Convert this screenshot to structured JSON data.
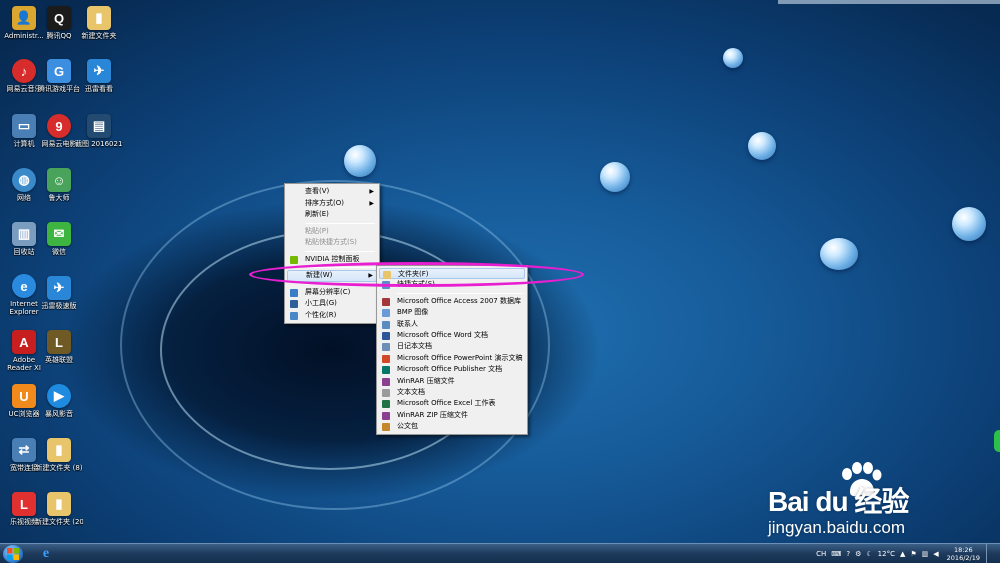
{
  "desktop": {
    "icons": [
      {
        "label": "Administr...",
        "glyph": "👤",
        "color": "#d9a630"
      },
      {
        "label": "腾讯QQ",
        "glyph": "Q",
        "color": "#1b1b1b"
      },
      {
        "label": "新建文件夹",
        "glyph": "▮",
        "color": "#e8c46a"
      },
      {
        "label": "网易云音乐",
        "glyph": "♪",
        "color": "#d62c2c"
      },
      {
        "label": "腾讯游戏平台",
        "glyph": "G",
        "color": "#3c8ee0"
      },
      {
        "label": "迅雷看看",
        "glyph": "✈",
        "color": "#2a86d6"
      },
      {
        "label": "计算机",
        "glyph": "▭",
        "color": "#4a7fb5"
      },
      {
        "label": "网易云电影",
        "glyph": "9",
        "color": "#d62c2c"
      },
      {
        "label": "截图 20160219...",
        "glyph": "▤",
        "color": "#234a70"
      },
      {
        "label": "网络",
        "glyph": "◍",
        "color": "#3a89c9"
      },
      {
        "label": "鲁大师",
        "glyph": "☺",
        "color": "#4aa35a"
      },
      {
        "label": "回收站",
        "glyph": "▥",
        "color": "#7a9cbf"
      },
      {
        "label": "微信",
        "glyph": "✉",
        "color": "#3fb541"
      },
      {
        "label": "Internet Explorer",
        "glyph": "e",
        "color": "#2a8ae0"
      },
      {
        "label": "迅雷极速版",
        "glyph": "✈",
        "color": "#2a86d6"
      },
      {
        "label": "Adobe Reader XI",
        "glyph": "A",
        "color": "#c71f1f"
      },
      {
        "label": "英雄联盟",
        "glyph": "L",
        "color": "#6f5a26"
      },
      {
        "label": "UC浏览器",
        "glyph": "U",
        "color": "#f08a1c"
      },
      {
        "label": "暴风影音",
        "glyph": "▶",
        "color": "#1f8be0"
      },
      {
        "label": "宽带连接",
        "glyph": "⇄",
        "color": "#4a7fb5"
      },
      {
        "label": "新建文件夹 (8)",
        "glyph": "▮",
        "color": "#e8c46a"
      },
      {
        "label": "乐视视频",
        "glyph": "L",
        "color": "#e03030"
      },
      {
        "label": "新建文件夹 (20)",
        "glyph": "▮",
        "color": "#e8c46a"
      }
    ]
  },
  "context_menu": {
    "items": [
      {
        "label": "查看(V)",
        "type": "submenu"
      },
      {
        "label": "排序方式(O)",
        "type": "submenu"
      },
      {
        "label": "刷新(E)",
        "type": "item"
      },
      {
        "label": "粘贴(P)",
        "type": "disabled"
      },
      {
        "label": "粘贴快捷方式(S)",
        "type": "disabled"
      },
      {
        "label": "NVIDIA 控制面板",
        "type": "item"
      },
      {
        "label": "新建(W)",
        "type": "submenu"
      },
      {
        "label": "屏幕分辨率(C)",
        "type": "item"
      },
      {
        "label": "小工具(G)",
        "type": "item"
      },
      {
        "label": "个性化(R)",
        "type": "item"
      }
    ]
  },
  "new_submenu": {
    "items": [
      {
        "label": "文件夹(F)",
        "icon_color": "#e8c46a"
      },
      {
        "label": "快捷方式(S)",
        "icon_color": "#5b8ec7"
      },
      {
        "label": "Microsoft Office Access 2007 数据库",
        "icon_color": "#a4373a"
      },
      {
        "label": "BMP 图像",
        "icon_color": "#6a9bd8"
      },
      {
        "label": "联系人",
        "icon_color": "#5a8cc0"
      },
      {
        "label": "Microsoft Office Word 文档",
        "icon_color": "#2b579a"
      },
      {
        "label": "日记本文档",
        "icon_color": "#6d8fb5"
      },
      {
        "label": "Microsoft Office PowerPoint 演示文稿",
        "icon_color": "#d24726"
      },
      {
        "label": "Microsoft Office Publisher 文档",
        "icon_color": "#077568"
      },
      {
        "label": "WinRAR 压缩文件",
        "icon_color": "#8a3f91"
      },
      {
        "label": "文本文档",
        "icon_color": "#9a9a9a"
      },
      {
        "label": "Microsoft Office Excel 工作表",
        "icon_color": "#217346"
      },
      {
        "label": "WinRAR ZIP 压缩文件",
        "icon_color": "#8a3f91"
      },
      {
        "label": "公文包",
        "icon_color": "#c5862c"
      }
    ]
  },
  "taskbar": {
    "tray": {
      "lang": "CH",
      "temperature": "12°C"
    },
    "clock": {
      "time": "18:26",
      "date": "2016/2/19"
    }
  },
  "watermark": {
    "brand": "Bai du 经验",
    "url": "jingyan.baidu.com"
  },
  "colors": {
    "annotation": "#e81fd0",
    "menu_bg": "#f0f0f0",
    "highlight": "#d5e6f9"
  }
}
